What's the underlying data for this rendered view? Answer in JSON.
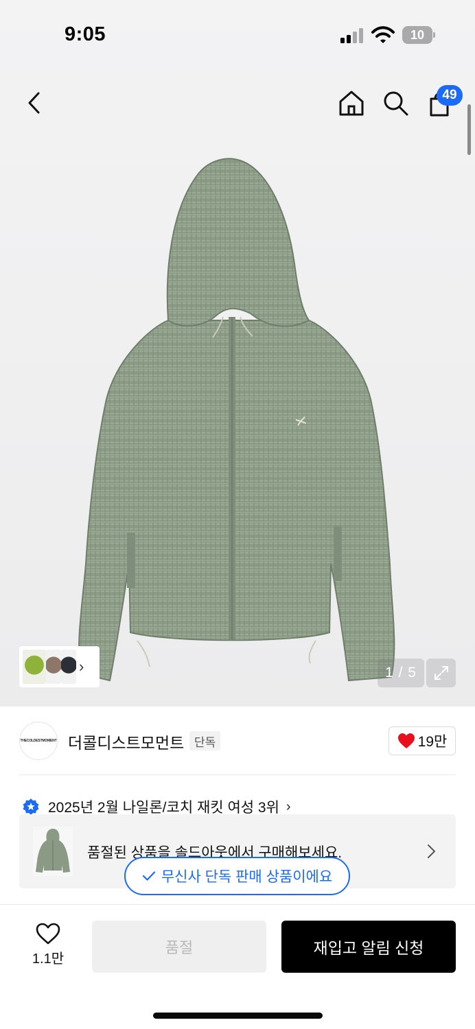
{
  "status_bar": {
    "time": "9:05",
    "battery": "10"
  },
  "nav": {
    "cart_count": "49"
  },
  "gallery": {
    "pager": "1 / 5"
  },
  "brand": {
    "name": "더콜디스트모먼트",
    "tag": "단독",
    "logo_text": "THECOLDESTMOMENT",
    "likes": "19만"
  },
  "ranking": {
    "text": "2025년 2월 나일론/코치 재킷 여성 3위",
    "icon_color": "#1d6af5"
  },
  "soldout_banner": {
    "text": "품절된 상품을 솔드아웃에서 구매해보세요."
  },
  "exclusive_pill": {
    "text": "무신사 단독 판매 상품이에요"
  },
  "bottom": {
    "wish_count": "1.1만",
    "soldout_label": "품절",
    "restock_label": "재입고 알림 신청"
  },
  "colors": {
    "accent": "#1d6af5",
    "like_heart": "#e8101c",
    "product": "#8a9a84"
  }
}
